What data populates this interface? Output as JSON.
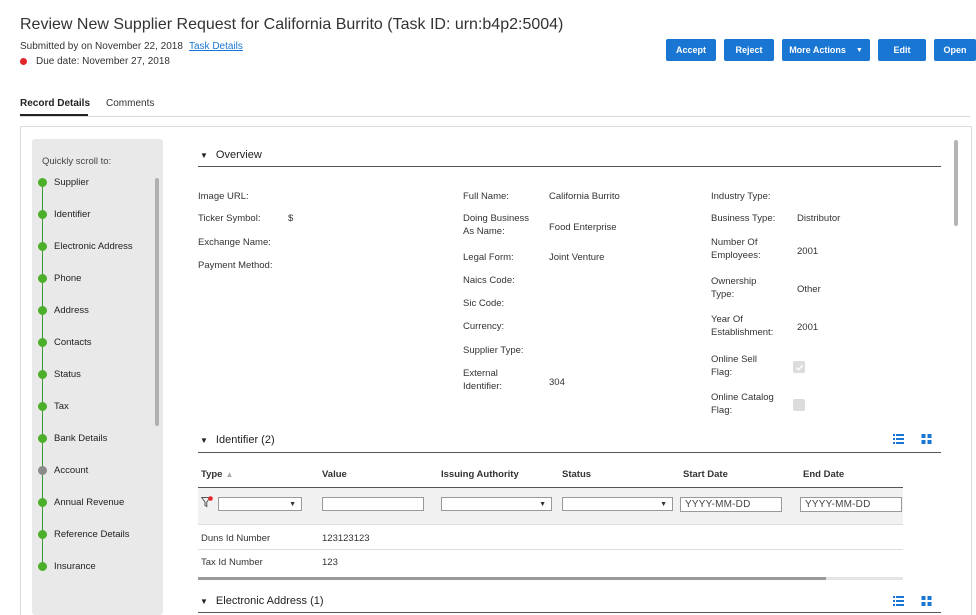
{
  "header": {
    "title": "Review New Supplier Request for California Burrito (Task ID: urn:b4p2:5004)",
    "submitted": "Submitted by on November 22, 2018",
    "task_details_link": "Task Details",
    "due_date": "Due date: November 27, 2018"
  },
  "actions": {
    "accept": "Accept",
    "reject": "Reject",
    "more_actions": "More Actions",
    "edit": "Edit",
    "open": "Open"
  },
  "tabs": {
    "record_details": "Record Details",
    "comments": "Comments"
  },
  "sidebar": {
    "scroll_label": "Quickly scroll to:",
    "items": [
      {
        "label": "Supplier"
      },
      {
        "label": "Identifier"
      },
      {
        "label": "Electronic Address"
      },
      {
        "label": "Phone"
      },
      {
        "label": "Address"
      },
      {
        "label": "Contacts"
      },
      {
        "label": "Status"
      },
      {
        "label": "Tax"
      },
      {
        "label": "Bank Details"
      },
      {
        "label": "Account"
      },
      {
        "label": "Annual Revenue"
      },
      {
        "label": "Reference Details"
      },
      {
        "label": "Insurance"
      }
    ]
  },
  "overview": {
    "heading": "Overview",
    "col1": [
      {
        "label": "Image URL:",
        "value": ""
      },
      {
        "label": "Ticker Symbol:",
        "value": "$"
      },
      {
        "label": "Exchange Name:",
        "value": ""
      },
      {
        "label": "Payment Method:",
        "value": ""
      }
    ],
    "col2": [
      {
        "label": "Full Name:",
        "value": "California Burrito"
      },
      {
        "label": "Doing Business As Name:",
        "value": "Food Enterprise"
      },
      {
        "label": "Legal Form:",
        "value": "Joint Venture"
      },
      {
        "label": "Naics Code:",
        "value": ""
      },
      {
        "label": "Sic Code:",
        "value": ""
      },
      {
        "label": "Currency:",
        "value": ""
      },
      {
        "label": "Supplier Type:",
        "value": ""
      },
      {
        "label": "External Identifier:",
        "value": "304"
      }
    ],
    "col3": [
      {
        "label": "Industry Type:",
        "value": ""
      },
      {
        "label": "Business Type:",
        "value": "Distributor"
      },
      {
        "label": "Number Of Employees:",
        "value": "2001"
      },
      {
        "label": "Ownership Type:",
        "value": "Other"
      },
      {
        "label": "Year Of Establishment:",
        "value": "2001"
      },
      {
        "label": "Online Sell Flag:",
        "value": ""
      },
      {
        "label": "Online Catalog Flag:",
        "value": ""
      }
    ]
  },
  "identifier": {
    "heading": "Identifier (2)",
    "columns": [
      "Type",
      "Value",
      "Issuing Authority",
      "Status",
      "Start Date",
      "End Date"
    ],
    "date_placeholder": "YYYY-MM-DD",
    "rows": [
      {
        "type": "Duns Id Number",
        "value": "123123123"
      },
      {
        "type": "Tax Id Number",
        "value": "123"
      }
    ]
  },
  "electronic_address": {
    "heading": "Electronic Address (1)"
  },
  "icons": [
    "list-view-icon",
    "grid-view-icon",
    "filter-icon",
    "caret-down-icon",
    "checkmark-icon"
  ],
  "colors": {
    "primary": "#1976d2",
    "status_green": "#4caf2a",
    "status_grey": "#8a8a8a",
    "due_red": "#e0262b"
  }
}
